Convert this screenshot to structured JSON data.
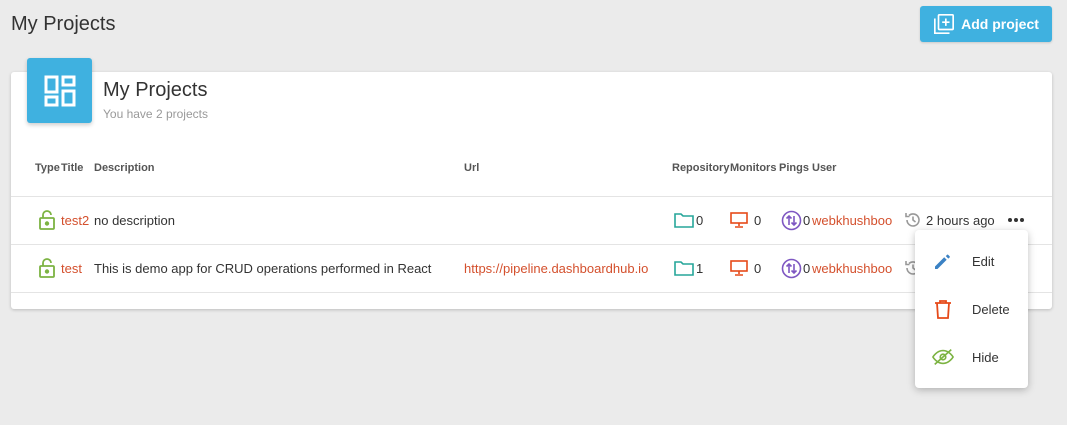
{
  "header": {
    "title": "My Projects",
    "add_button_label": "Add project"
  },
  "card": {
    "title": "My Projects",
    "subtitle": "You have 2 projects"
  },
  "table": {
    "columns": {
      "type": "Type",
      "title": "Title",
      "description": "Description",
      "url": "Url",
      "repository": "Repository",
      "monitors": "Monitors",
      "pings": "Pings",
      "user": "User"
    },
    "rows": [
      {
        "title": "test2",
        "description": "no description",
        "url": "",
        "repository": "0",
        "monitors": "0",
        "pings": "0",
        "user": "webkhushboo",
        "time": "2 hours ago"
      },
      {
        "title": "test",
        "description": "This is demo app for CRUD operations performed in React",
        "url": "https://pipeline.dashboardhub.io",
        "repository": "1",
        "monitors": "0",
        "pings": "0",
        "user": "webkhushboo",
        "time": ""
      }
    ]
  },
  "menu": {
    "items": [
      {
        "label": "Edit",
        "icon": "pencil-icon"
      },
      {
        "label": "Delete",
        "icon": "trash-icon"
      },
      {
        "label": "Hide",
        "icon": "eye-off-icon"
      }
    ]
  },
  "colors": {
    "accent": "#3fb1e0",
    "link": "#d4502d",
    "lock": "#7cb342",
    "folder": "#26a69a",
    "monitor": "#e64a19",
    "ping": "#7e57c2"
  }
}
